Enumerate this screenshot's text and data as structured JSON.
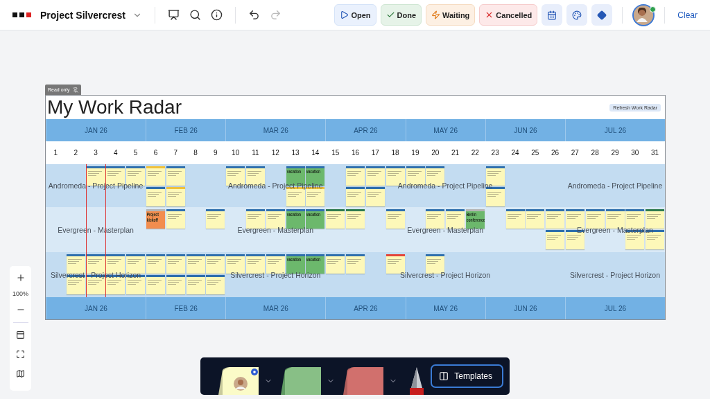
{
  "toolbar": {
    "project": "Project Silvercrest",
    "status_filters": [
      {
        "kind": "open",
        "label": "Open"
      },
      {
        "kind": "done",
        "label": "Done"
      },
      {
        "kind": "waiting",
        "label": "Waiting"
      },
      {
        "kind": "cancelled",
        "label": "Cancelled"
      }
    ],
    "clear": "Clear",
    "redo_disabled": true
  },
  "board": {
    "badge": "Read only",
    "title": "My Work Radar",
    "refresh": "Refresh Work Radar",
    "months": [
      "JAN 26",
      "FEB 26",
      "MAR 26",
      "APR 26",
      "MAY 26",
      "JUN 26",
      "JUL 26"
    ],
    "days": [
      "1",
      "2",
      "3",
      "4",
      "5",
      "6",
      "7",
      "8",
      "9",
      "10",
      "11",
      "12",
      "13",
      "14",
      "15",
      "16",
      "17",
      "18",
      "19",
      "20",
      "21",
      "22",
      "23",
      "24",
      "25",
      "26",
      "27",
      "28",
      "29",
      "30",
      "31"
    ],
    "lanes": [
      {
        "labels": [
          "Andromeda - Project Pipeline",
          "Andromeda - Project Pipeline",
          "Andromeda - Project Pipeline",
          "Andromeda - Project Pipeline"
        ],
        "notes": [
          {
            "kind": "task",
            "color": "#2f6fad"
          },
          {
            "kind": "task",
            "color": "#2f6fad"
          },
          {
            "kind": "task",
            "color": "#2f6fad"
          },
          {
            "kind": "task",
            "color": "#f0c23b"
          },
          {
            "kind": "task",
            "color": "#2f6fad"
          },
          {
            "kind": "task",
            "color": "#2f6fad"
          },
          {
            "kind": "task",
            "color": "#2f6fad"
          },
          {
            "kind": "vacation",
            "color": "#2f6fad",
            "text": "vacation"
          },
          {
            "kind": "vacation",
            "color": "#2f6fad",
            "text": "vacation"
          },
          {
            "kind": "task",
            "color": "#2f6fad"
          },
          {
            "kind": "task",
            "color": "#2f6fad"
          },
          {
            "kind": "task",
            "color": "#2f6fad"
          },
          {
            "kind": "task",
            "color": "#2f6fad"
          },
          {
            "kind": "task",
            "color": "#2f6fad"
          },
          {
            "kind": "task",
            "color": "#2f6fad"
          },
          {
            "kind": "task",
            "color": "#2f6fad"
          },
          {
            "kind": "task",
            "color": "#f0c23b"
          },
          {
            "kind": "task",
            "color": "#f0c23b"
          },
          {
            "kind": "task",
            "color": "#f0c23b"
          },
          {
            "kind": "task",
            "color": "#2f6fad"
          },
          {
            "kind": "task",
            "color": "#2f6fad"
          },
          {
            "kind": "task",
            "color": "#2f6fad"
          }
        ]
      },
      {
        "labels": [
          "Evergreen - Masterplan",
          "Evergreen - Masterplan",
          "Evergreen - Masterplan",
          "Evergreen - Masterplan"
        ],
        "notes": [
          {
            "kind": "milestone",
            "color": "#b5b5b5",
            "text": "Project kickoff"
          },
          {
            "kind": "task",
            "color": "#2f6fad"
          },
          {
            "kind": "task",
            "color": "#2f6fad"
          },
          {
            "kind": "task",
            "color": "#2f6fad"
          },
          {
            "kind": "task",
            "color": "#2f6fad"
          },
          {
            "kind": "vacation",
            "color": "#2f6fad",
            "text": "vacation"
          },
          {
            "kind": "vacation",
            "color": "#2f6fad",
            "text": "vacation"
          },
          {
            "kind": "task",
            "color": "#2c7a4e"
          },
          {
            "kind": "task",
            "color": "#2c7a4e"
          },
          {
            "kind": "task",
            "color": "#2f6fad"
          },
          {
            "kind": "task",
            "color": "#2f6fad"
          },
          {
            "kind": "task",
            "color": "#2f6fad"
          },
          {
            "kind": "vacation",
            "color": "#b5b5b5",
            "text": "Berlin conference"
          },
          {
            "kind": "task",
            "color": "#2f6fad"
          },
          {
            "kind": "task",
            "color": "#2f6fad"
          },
          {
            "kind": "task",
            "color": "#2f6fad"
          },
          {
            "kind": "task",
            "color": "#2f6fad"
          },
          {
            "kind": "task",
            "color": "#2f6fad"
          },
          {
            "kind": "task",
            "color": "#2f6fad"
          },
          {
            "kind": "task",
            "color": "#2f6fad"
          },
          {
            "kind": "task",
            "color": "#2c7a4e"
          },
          {
            "kind": "task",
            "color": "#2f6fad"
          },
          {
            "kind": "task",
            "color": "#2f6fad"
          },
          {
            "kind": "task",
            "color": "#2f6fad"
          },
          {
            "kind": "task",
            "color": "#2f6fad"
          }
        ]
      },
      {
        "labels": [
          "Silvercrest - Project Horizon",
          "Silvercrest - Project Horizon",
          "Silvercrest - Project Horizon",
          "Silvercrest - Project Horizon"
        ],
        "notes": [
          {
            "kind": "task",
            "color": "#2f6fad"
          },
          {
            "kind": "task",
            "color": "#2f6fad"
          },
          {
            "kind": "task",
            "color": "#2f6fad"
          },
          {
            "kind": "task",
            "color": "#2f6fad"
          },
          {
            "kind": "task",
            "color": "#2f6fad"
          },
          {
            "kind": "task",
            "color": "#2f6fad"
          },
          {
            "kind": "task",
            "color": "#2f6fad"
          },
          {
            "kind": "task",
            "color": "#2f6fad"
          },
          {
            "kind": "task",
            "color": "#2f6fad"
          },
          {
            "kind": "task",
            "color": "#2f6fad"
          },
          {
            "kind": "task",
            "color": "#2f6fad"
          },
          {
            "kind": "vacation",
            "color": "#2f6fad",
            "text": "vacation"
          },
          {
            "kind": "vacation",
            "color": "#2f6fad",
            "text": "vacation"
          },
          {
            "kind": "task",
            "color": "#2f6fad"
          },
          {
            "kind": "task",
            "color": "#2f6fad"
          },
          {
            "kind": "task",
            "color": "#e2443a"
          },
          {
            "kind": "task",
            "color": "#2f6fad"
          },
          {
            "kind": "task",
            "color": "#2f6fad"
          },
          {
            "kind": "task",
            "color": "#2f6fad"
          },
          {
            "kind": "task",
            "color": "#2f6fad"
          },
          {
            "kind": "task",
            "color": "#2f6fad"
          },
          {
            "kind": "task",
            "color": "#2f6fad"
          },
          {
            "kind": "task",
            "color": "#2f6fad"
          },
          {
            "kind": "task",
            "color": "#2f6fad"
          },
          {
            "kind": "task",
            "color": "#2f6fad"
          }
        ]
      }
    ],
    "footer_months": [
      "JAN 26",
      "FEB 26",
      "MAR 26",
      "APR 26",
      "MAY 26",
      "JUN 26",
      "JUL 26"
    ]
  },
  "zoom": {
    "level": "100%"
  },
  "dock": {
    "notes": [
      {
        "kind": "yellow"
      },
      {
        "kind": "green"
      },
      {
        "kind": "red"
      }
    ],
    "templates": "Templates"
  }
}
